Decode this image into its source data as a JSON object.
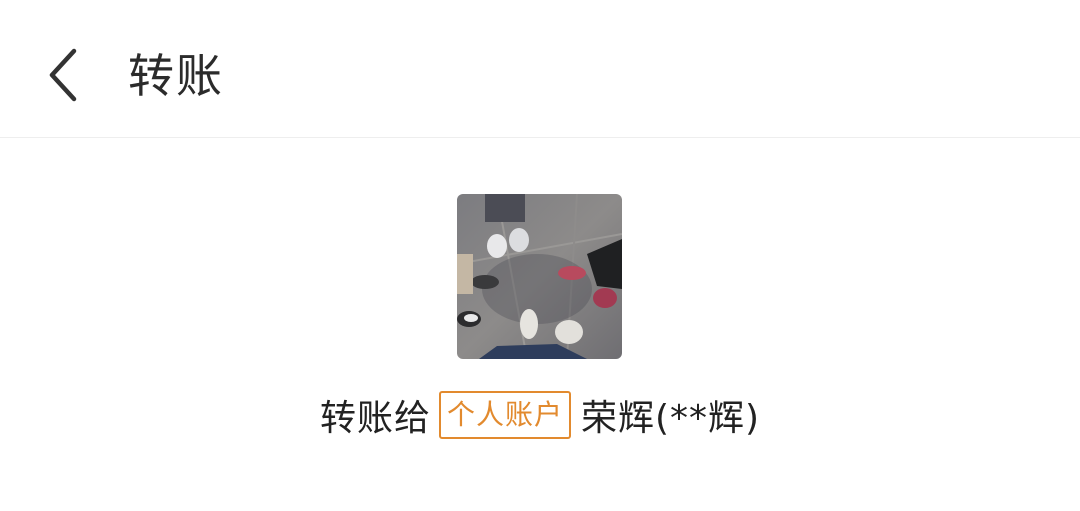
{
  "header": {
    "title": "转账",
    "back_icon": "chevron-left-icon"
  },
  "recipient": {
    "prefix": "转账给",
    "account_type_badge": "个人账户",
    "name": "荣辉(**辉)",
    "avatar_description": "photo of several feet in sneakers on pavement"
  },
  "colors": {
    "badge": "#e28a2e",
    "text": "#222222",
    "divider": "#eeeeee"
  }
}
